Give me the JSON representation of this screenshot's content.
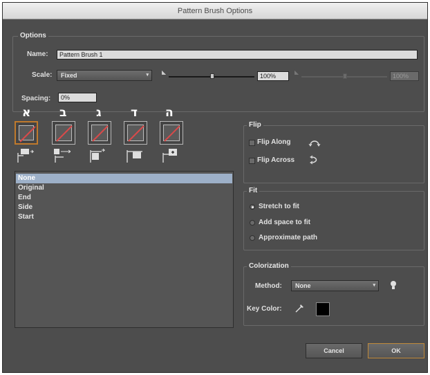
{
  "window": {
    "title": "Pattern Brush Options"
  },
  "options": {
    "legend": "Options",
    "name_label": "Name:",
    "name_value": "Pattern Brush 1",
    "scale_label": "Scale:",
    "scale_method": "Fixed",
    "scale_value": "100%",
    "scale_value2": "100%",
    "spacing_label": "Spacing:",
    "spacing_value": "0%"
  },
  "tiles": {
    "labels": [
      "א",
      "ב",
      "ג",
      "ד",
      "ה"
    ],
    "items": [
      {
        "name": "side-tile",
        "selected": true,
        "icon": "side-tile-icon"
      },
      {
        "name": "outer-corner-tile",
        "selected": false,
        "icon": "outer-corner-tile-icon"
      },
      {
        "name": "inner-corner-tile",
        "selected": false,
        "icon": "inner-corner-tile-icon"
      },
      {
        "name": "start-tile",
        "selected": false,
        "icon": "start-tile-icon"
      },
      {
        "name": "end-tile",
        "selected": false,
        "icon": "end-tile-icon"
      }
    ]
  },
  "pattern_list": {
    "items": [
      "None",
      "Original",
      "End",
      "Side",
      "Start"
    ],
    "selected_index": 0
  },
  "flip": {
    "legend": "Flip",
    "along_label": "Flip Along",
    "across_label": "Flip Across",
    "along_checked": false,
    "across_checked": false
  },
  "fit": {
    "legend": "Fit",
    "options": [
      "Stretch to fit",
      "Add space to fit",
      "Approximate path"
    ],
    "selected_index": 0
  },
  "colorization": {
    "legend": "Colorization",
    "method_label": "Method:",
    "method_value": "None",
    "key_color_label": "Key Color:",
    "key_color": "#000000"
  },
  "buttons": {
    "cancel": "Cancel",
    "ok": "OK"
  },
  "colors": {
    "dialog_bg": "#4d4d4d",
    "selection_accent": "#c07a2c",
    "list_selection": "#9db0c8",
    "tile_stroke": "#d94a4a"
  }
}
